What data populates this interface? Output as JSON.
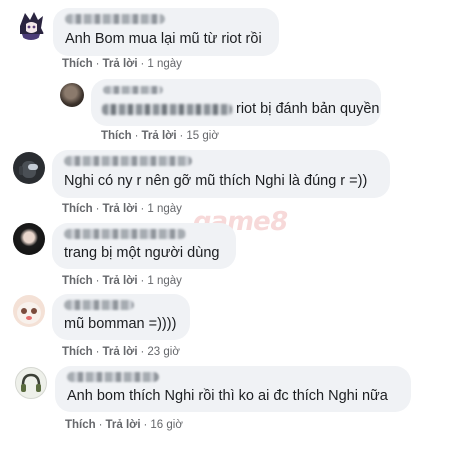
{
  "watermark": "game8",
  "actions": {
    "like": "Thích",
    "reply": "Trả lời",
    "dot": "·"
  },
  "comments": [
    {
      "text": "Anh Bom mua lại mũ từ riot rồi",
      "time": "1 ngày"
    },
    {
      "text": "riot bị đánh bản quyền",
      "time": "15 giờ"
    },
    {
      "text": "Nghi có ny r nên gỡ mũ thích Nghi là đúng r =))",
      "time": "1 ngày"
    },
    {
      "text": "trang bị một người dùng",
      "time": "1 ngày"
    },
    {
      "text": "mũ bomman =))))",
      "time": "23 giờ"
    },
    {
      "text": "Anh bom thích Nghi rồi thì ko ai đc thích Nghi nữa",
      "time": "16 giờ"
    }
  ]
}
